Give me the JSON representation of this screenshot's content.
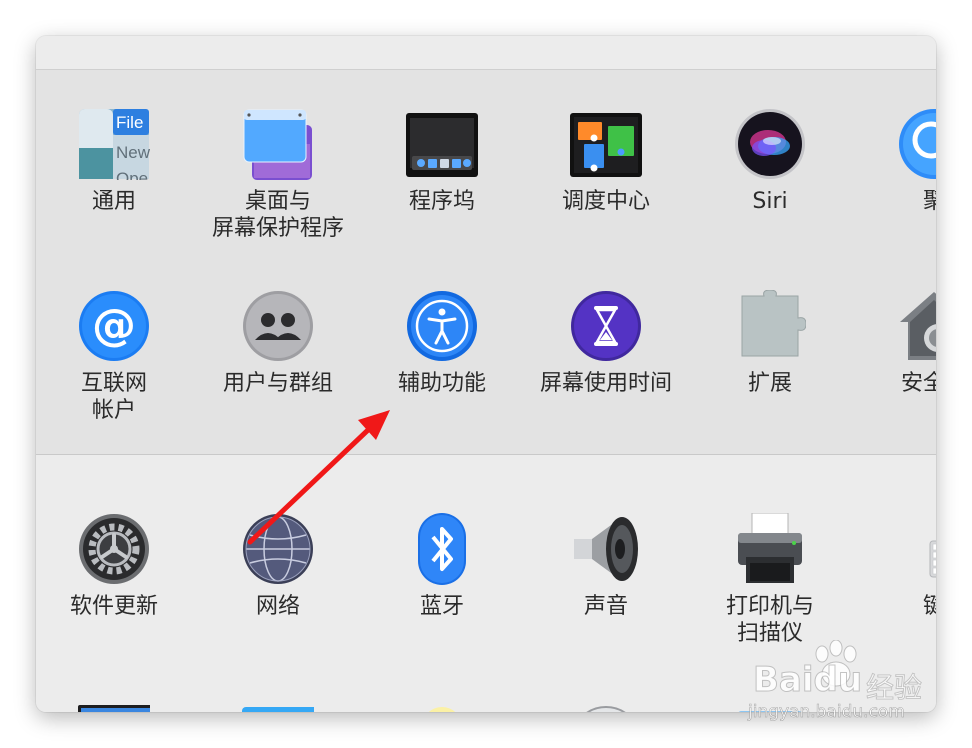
{
  "sections": {
    "personal": {
      "row1": [
        {
          "label": "通用"
        },
        {
          "label": "桌面与\n屏幕保护程序"
        },
        {
          "label": "程序坞"
        },
        {
          "label": "调度中心"
        },
        {
          "label": "Siri"
        },
        {
          "label": "聚"
        }
      ],
      "row2": [
        {
          "label": "互联网\n帐户"
        },
        {
          "label": "用户与群组"
        },
        {
          "label": "辅助功能"
        },
        {
          "label": "屏幕使用时间"
        },
        {
          "label": "扩展"
        },
        {
          "label": "安全性"
        }
      ]
    },
    "hardware": {
      "row1": [
        {
          "label": "软件更新"
        },
        {
          "label": "网络"
        },
        {
          "label": "蓝牙"
        },
        {
          "label": "声音"
        },
        {
          "label": "打印机与\n扫描仪"
        },
        {
          "label": "键"
        }
      ]
    }
  },
  "general_icon_text": {
    "line1": "File",
    "line2": "New",
    "line3": "Ope"
  },
  "watermark": {
    "brand": "Bai",
    "brand2": "du",
    "cn": "经验",
    "url": "jingyan.baidu.com"
  },
  "colors": {
    "accent": "#1a82fb",
    "annotation_arrow": "#f01818"
  }
}
